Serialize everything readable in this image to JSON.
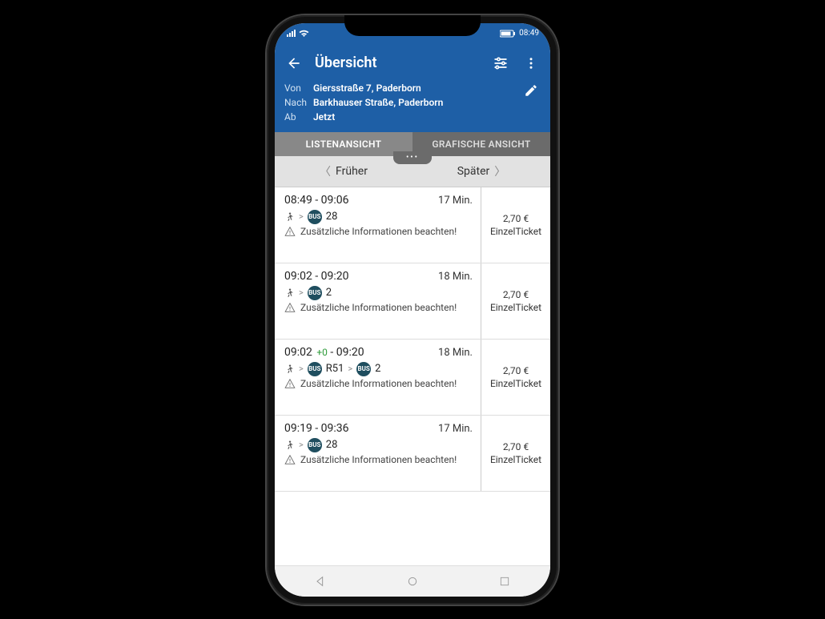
{
  "statusbar": {
    "time": "08:49"
  },
  "header": {
    "title": "Übersicht",
    "from_label": "Von",
    "to_label": "Nach",
    "depart_label": "Ab",
    "from_value": "Giersstraße 7, Paderborn",
    "to_value": "Barkhauser Straße, Paderborn",
    "depart_value": "Jetzt"
  },
  "tabs": {
    "list": "LISTENANSICHT",
    "graphic": "GRAFISCHE ANSICHT"
  },
  "paging": {
    "earlier": "Früher",
    "later": "Später"
  },
  "badges": {
    "bus": "BUS"
  },
  "note": "Zusätzliche Informationen beachten!",
  "results": [
    {
      "time_range": "08:49 - 09:06",
      "delay": "",
      "duration": "17 Min.",
      "legs": [
        {
          "mode": "walk"
        },
        {
          "mode": "bus",
          "line": "28"
        }
      ],
      "price": "2,70 €",
      "ticket": "EinzelTicket"
    },
    {
      "time_range": "09:02 - 09:20",
      "delay": "",
      "duration": "18 Min.",
      "legs": [
        {
          "mode": "walk"
        },
        {
          "mode": "bus",
          "line": "2"
        }
      ],
      "price": "2,70 €",
      "ticket": "EinzelTicket"
    },
    {
      "time_range": "09:02",
      "time_range_suffix": " - 09:20",
      "delay": "+0",
      "duration": "18 Min.",
      "legs": [
        {
          "mode": "walk"
        },
        {
          "mode": "bus",
          "line": "R51"
        },
        {
          "mode": "bus",
          "line": "2"
        }
      ],
      "price": "2,70 €",
      "ticket": "EinzelTicket"
    },
    {
      "time_range": "09:19 - 09:36",
      "delay": "",
      "duration": "17 Min.",
      "legs": [
        {
          "mode": "walk"
        },
        {
          "mode": "bus",
          "line": "28"
        }
      ],
      "price": "2,70 €",
      "ticket": "EinzelTicket"
    }
  ]
}
